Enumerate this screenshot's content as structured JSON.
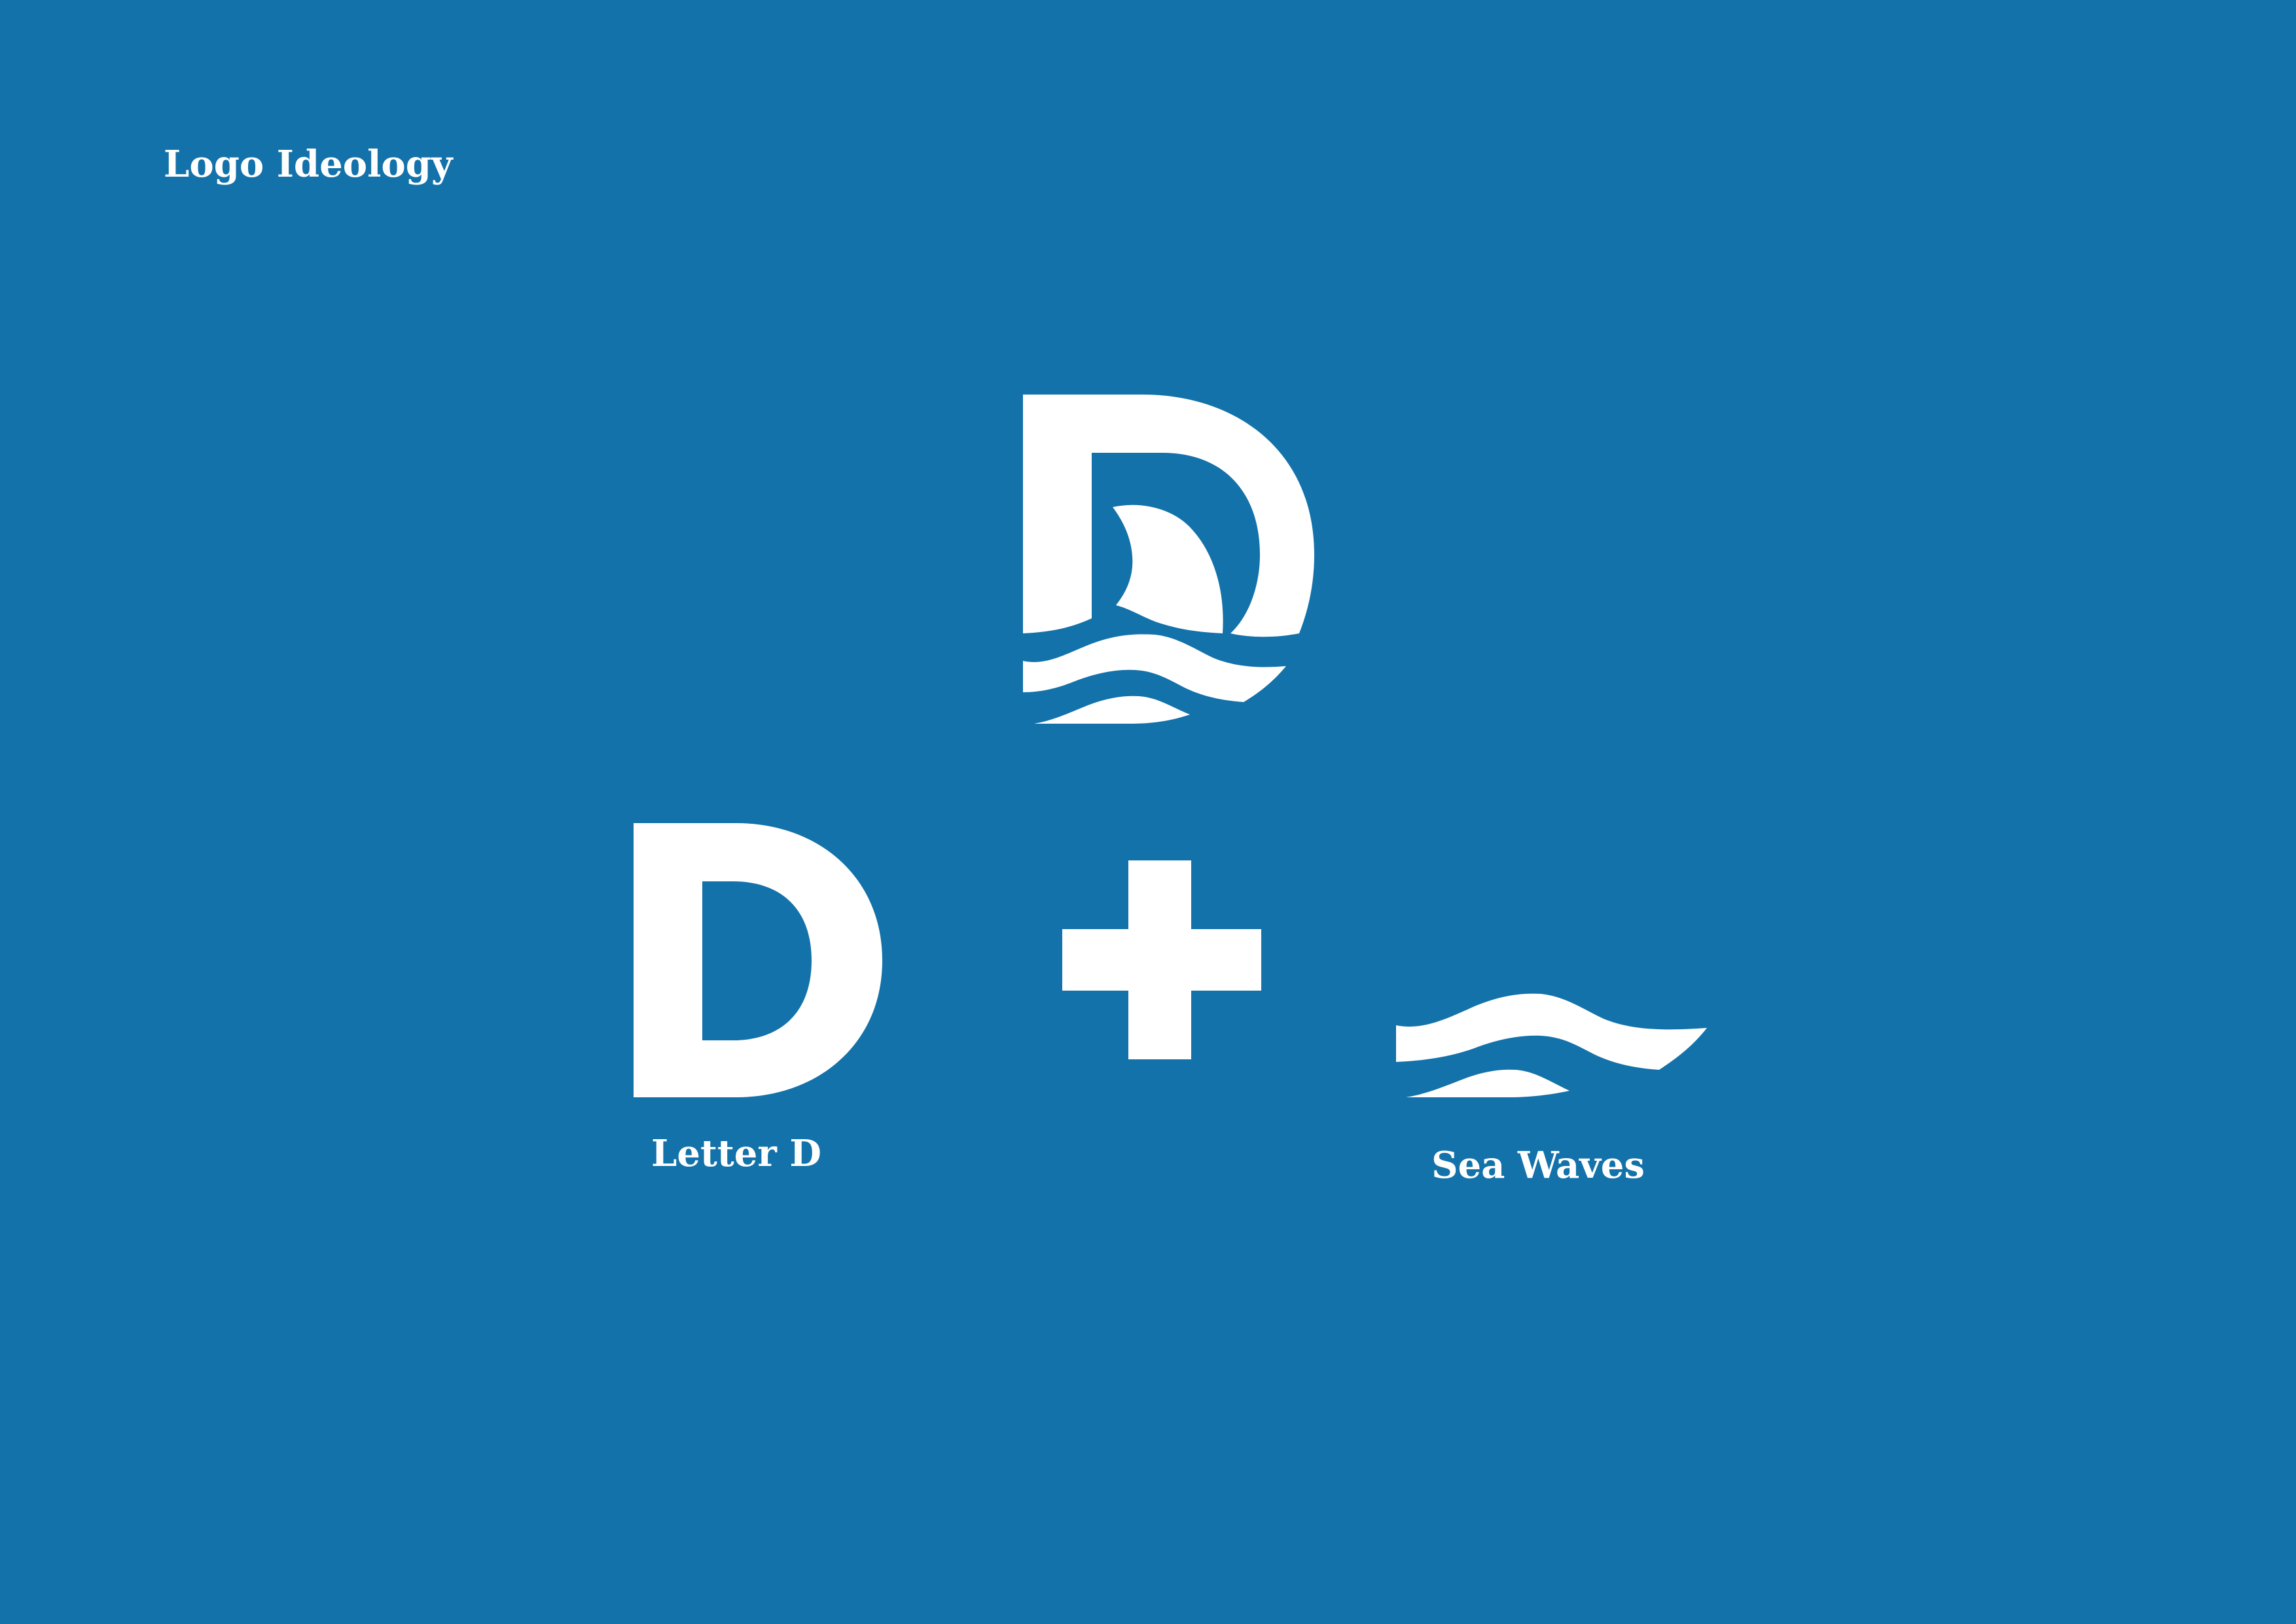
{
  "title": "Logo Ideology",
  "letter_label": "Letter D",
  "waves_label": "Sea Waves",
  "colors": {
    "background": "#1472aa",
    "mark": "#ffffff"
  },
  "icons": {
    "combined": "letter-d-with-shark-fin-and-waves-icon",
    "letter": "letter-d-icon",
    "operator": "plus-icon",
    "element": "shark-fin-sea-waves-icon"
  }
}
